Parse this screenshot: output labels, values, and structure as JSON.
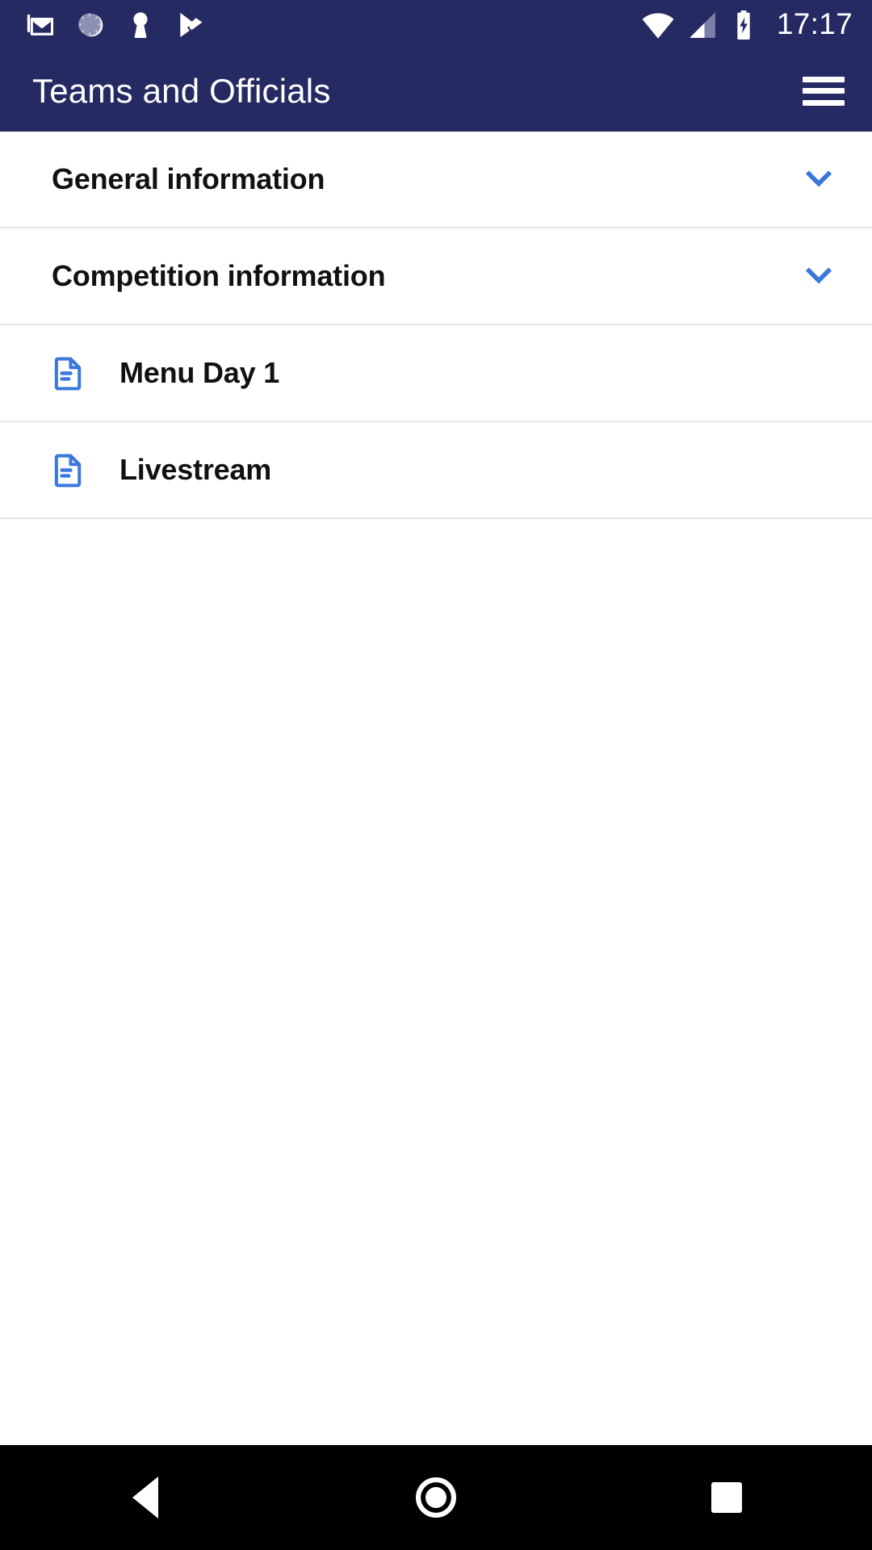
{
  "status_bar": {
    "time": "17:17",
    "left_icons": [
      {
        "name": "gmail-icon",
        "label": "Gmail"
      },
      {
        "name": "dial-progress-icon",
        "label": "Sync"
      },
      {
        "name": "vpn-key-icon",
        "label": "VPN"
      },
      {
        "name": "play-store-update-icon",
        "label": "Play Store"
      }
    ],
    "right_icons": [
      {
        "name": "wifi-icon",
        "label": "Wi-Fi"
      },
      {
        "name": "cellular-signal-icon",
        "label": "Signal"
      },
      {
        "name": "battery-charging-icon",
        "label": "Battery charging"
      }
    ],
    "background_color": "#262a63"
  },
  "app_bar": {
    "title": "Teams and Officials",
    "menu_label": "Menu",
    "background_color": "#262a63",
    "text_color": "#ffffff"
  },
  "colors": {
    "accent_blue": "#3b78dc",
    "divider": "#e6e6e6",
    "text_primary": "#111111",
    "surface": "#ffffff"
  },
  "list": {
    "rows": [
      {
        "type": "expandable",
        "label": "General information",
        "icon": "chevron-down-icon",
        "expanded": false
      },
      {
        "type": "expandable",
        "label": "Competition information",
        "icon": "chevron-down-icon",
        "expanded": false
      },
      {
        "type": "document",
        "label": "Menu Day 1",
        "icon": "document-icon"
      },
      {
        "type": "document",
        "label": "Livestream",
        "icon": "document-icon"
      }
    ]
  },
  "nav_bar": {
    "back_label": "Back",
    "home_label": "Home",
    "recents_label": "Recents",
    "background_color": "#000000"
  }
}
